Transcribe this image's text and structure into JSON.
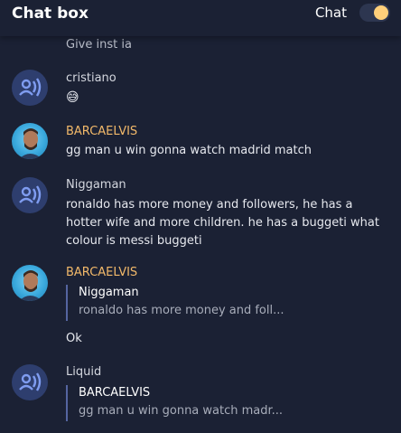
{
  "header": {
    "title": "Chat box",
    "toggle_label": "Chat"
  },
  "scroll_edge_text": "Give inst ia",
  "messages": [
    {
      "username": "cristiano",
      "text": "😅"
    },
    {
      "username": "BARCAELVIS",
      "text": "gg man u win gonna watch madrid match"
    },
    {
      "username": "Niggaman",
      "text": "ronaldo has more money and followers, he has a hotter wife and more children. he has a buggeti what colour is messi buggeti"
    },
    {
      "username": "BARCAELVIS",
      "quote_user": "Niggaman",
      "quote_text": "ronaldo has more money and foll...",
      "text": "Ok"
    },
    {
      "username": "Liquid",
      "quote_user": "BARCAELVIS",
      "quote_text": "gg man u win gonna watch madr..."
    }
  ],
  "colors": {
    "accent_username": "#f2b96a",
    "toggle_on": "#ffcf7a",
    "background": "#1b2134"
  }
}
